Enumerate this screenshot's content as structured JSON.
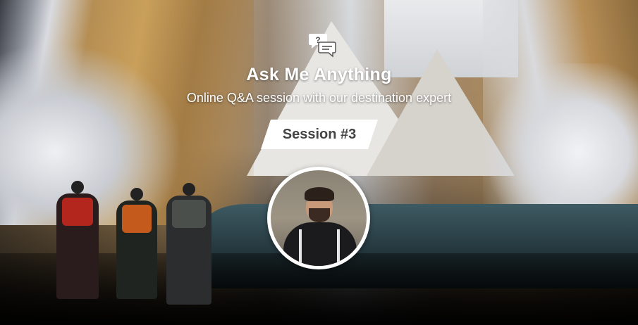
{
  "banner": {
    "title": "Ask Me Anything",
    "subtitle": "Online Q&A session with our destination expert",
    "session_label": "Session #3"
  },
  "icons": {
    "chat": "chat-bubbles-question-icon"
  },
  "colors": {
    "text": "#ffffff",
    "badge_bg": "#ffffff",
    "badge_text": "#444444"
  }
}
